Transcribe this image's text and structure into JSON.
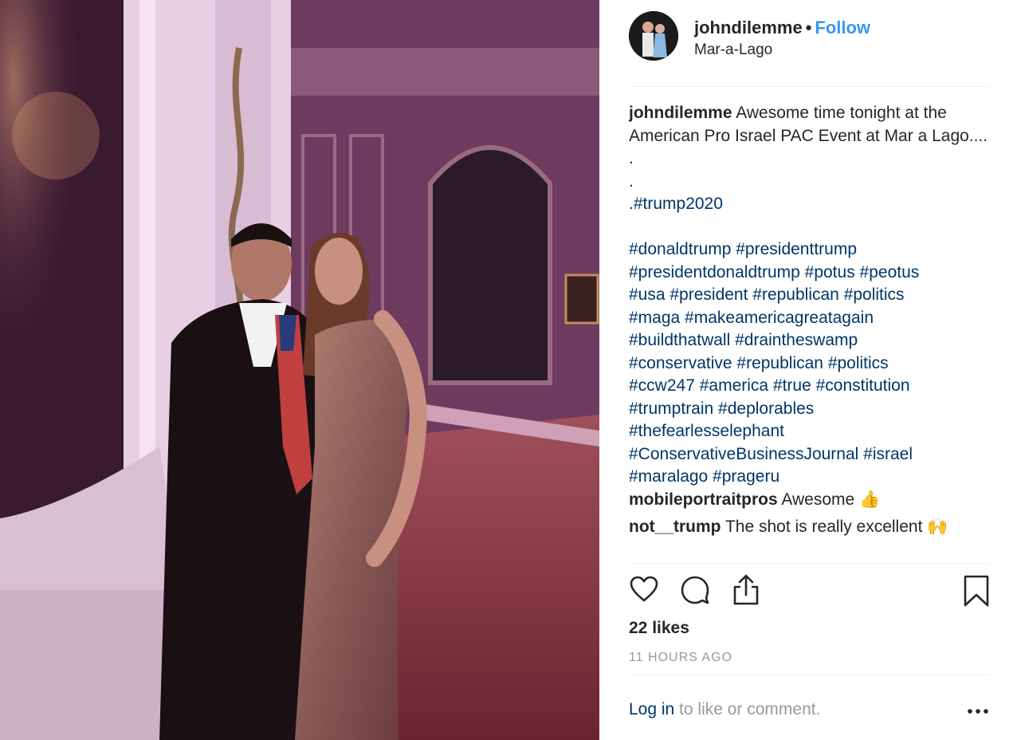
{
  "post": {
    "username": "johndilemme",
    "separator": "•",
    "follow_label": "Follow",
    "location": "Mar-a-Lago"
  },
  "caption": {
    "username": "johndilemme",
    "text": "Awesome time tonight at the American Pro Israel PAC Event at Mar a Lago....",
    "dot1": ".",
    "dot2": ".",
    "first_tag": ".#trump2020",
    "hashtag_lines": [
      "#donaldtrump #presidenttrump",
      "#presidentdonaldtrump #potus #peotus",
      "#usa #president #republican #politics",
      "#maga #makeamericagreatagain",
      "#buildthatwall #draintheswamp",
      "#conservative #republican #politics",
      "#ccw247 #america #true #constitution",
      "#trumptrain #deplorables",
      "#thefearlesselephant",
      "#ConservativeBusinessJournal #israel",
      "#maralago #prageru"
    ]
  },
  "comments": [
    {
      "username": "mobileportraitpros",
      "text": "Awesome 👍"
    },
    {
      "username": "not__trump",
      "text": "The shot is really excellent 🙌"
    }
  ],
  "actions": {
    "like_icon": "heart-icon",
    "comment_icon": "comment-bubble-icon",
    "share_icon": "share-icon",
    "save_icon": "bookmark-icon"
  },
  "likes_text": "22 likes",
  "time_text": "11 HOURS AGO",
  "login": {
    "link_text": "Log in",
    "rest_text": " to like or comment."
  },
  "colors": {
    "follow": "#3897f0",
    "hashtag": "#003569",
    "muted": "#999999"
  }
}
